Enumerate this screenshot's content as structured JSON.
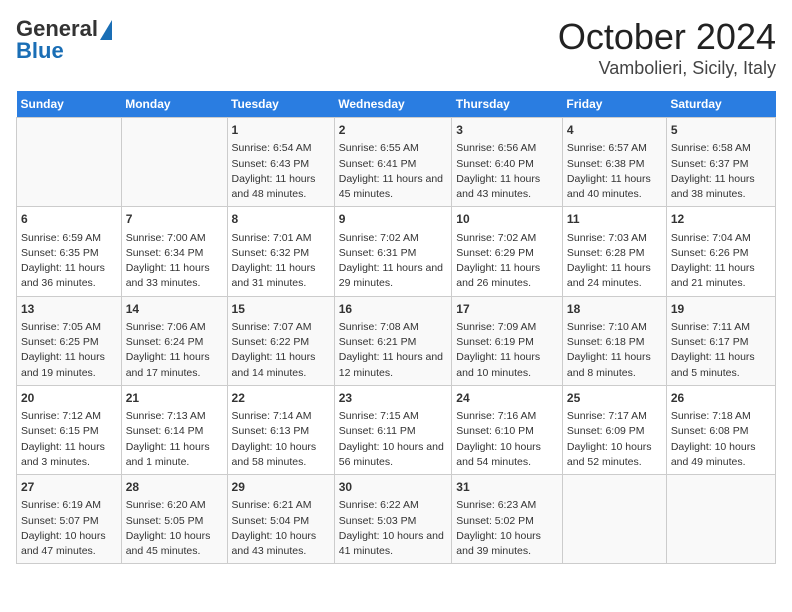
{
  "header": {
    "logo_line1": "General",
    "logo_line2": "Blue",
    "title": "October 2024",
    "subtitle": "Vambolieri, Sicily, Italy"
  },
  "days_of_week": [
    "Sunday",
    "Monday",
    "Tuesday",
    "Wednesday",
    "Thursday",
    "Friday",
    "Saturday"
  ],
  "weeks": [
    [
      {
        "day": "",
        "content": ""
      },
      {
        "day": "",
        "content": ""
      },
      {
        "day": "1",
        "content": "Sunrise: 6:54 AM\nSunset: 6:43 PM\nDaylight: 11 hours and 48 minutes."
      },
      {
        "day": "2",
        "content": "Sunrise: 6:55 AM\nSunset: 6:41 PM\nDaylight: 11 hours and 45 minutes."
      },
      {
        "day": "3",
        "content": "Sunrise: 6:56 AM\nSunset: 6:40 PM\nDaylight: 11 hours and 43 minutes."
      },
      {
        "day": "4",
        "content": "Sunrise: 6:57 AM\nSunset: 6:38 PM\nDaylight: 11 hours and 40 minutes."
      },
      {
        "day": "5",
        "content": "Sunrise: 6:58 AM\nSunset: 6:37 PM\nDaylight: 11 hours and 38 minutes."
      }
    ],
    [
      {
        "day": "6",
        "content": "Sunrise: 6:59 AM\nSunset: 6:35 PM\nDaylight: 11 hours and 36 minutes."
      },
      {
        "day": "7",
        "content": "Sunrise: 7:00 AM\nSunset: 6:34 PM\nDaylight: 11 hours and 33 minutes."
      },
      {
        "day": "8",
        "content": "Sunrise: 7:01 AM\nSunset: 6:32 PM\nDaylight: 11 hours and 31 minutes."
      },
      {
        "day": "9",
        "content": "Sunrise: 7:02 AM\nSunset: 6:31 PM\nDaylight: 11 hours and 29 minutes."
      },
      {
        "day": "10",
        "content": "Sunrise: 7:02 AM\nSunset: 6:29 PM\nDaylight: 11 hours and 26 minutes."
      },
      {
        "day": "11",
        "content": "Sunrise: 7:03 AM\nSunset: 6:28 PM\nDaylight: 11 hours and 24 minutes."
      },
      {
        "day": "12",
        "content": "Sunrise: 7:04 AM\nSunset: 6:26 PM\nDaylight: 11 hours and 21 minutes."
      }
    ],
    [
      {
        "day": "13",
        "content": "Sunrise: 7:05 AM\nSunset: 6:25 PM\nDaylight: 11 hours and 19 minutes."
      },
      {
        "day": "14",
        "content": "Sunrise: 7:06 AM\nSunset: 6:24 PM\nDaylight: 11 hours and 17 minutes."
      },
      {
        "day": "15",
        "content": "Sunrise: 7:07 AM\nSunset: 6:22 PM\nDaylight: 11 hours and 14 minutes."
      },
      {
        "day": "16",
        "content": "Sunrise: 7:08 AM\nSunset: 6:21 PM\nDaylight: 11 hours and 12 minutes."
      },
      {
        "day": "17",
        "content": "Sunrise: 7:09 AM\nSunset: 6:19 PM\nDaylight: 11 hours and 10 minutes."
      },
      {
        "day": "18",
        "content": "Sunrise: 7:10 AM\nSunset: 6:18 PM\nDaylight: 11 hours and 8 minutes."
      },
      {
        "day": "19",
        "content": "Sunrise: 7:11 AM\nSunset: 6:17 PM\nDaylight: 11 hours and 5 minutes."
      }
    ],
    [
      {
        "day": "20",
        "content": "Sunrise: 7:12 AM\nSunset: 6:15 PM\nDaylight: 11 hours and 3 minutes."
      },
      {
        "day": "21",
        "content": "Sunrise: 7:13 AM\nSunset: 6:14 PM\nDaylight: 11 hours and 1 minute."
      },
      {
        "day": "22",
        "content": "Sunrise: 7:14 AM\nSunset: 6:13 PM\nDaylight: 10 hours and 58 minutes."
      },
      {
        "day": "23",
        "content": "Sunrise: 7:15 AM\nSunset: 6:11 PM\nDaylight: 10 hours and 56 minutes."
      },
      {
        "day": "24",
        "content": "Sunrise: 7:16 AM\nSunset: 6:10 PM\nDaylight: 10 hours and 54 minutes."
      },
      {
        "day": "25",
        "content": "Sunrise: 7:17 AM\nSunset: 6:09 PM\nDaylight: 10 hours and 52 minutes."
      },
      {
        "day": "26",
        "content": "Sunrise: 7:18 AM\nSunset: 6:08 PM\nDaylight: 10 hours and 49 minutes."
      }
    ],
    [
      {
        "day": "27",
        "content": "Sunrise: 6:19 AM\nSunset: 5:07 PM\nDaylight: 10 hours and 47 minutes."
      },
      {
        "day": "28",
        "content": "Sunrise: 6:20 AM\nSunset: 5:05 PM\nDaylight: 10 hours and 45 minutes."
      },
      {
        "day": "29",
        "content": "Sunrise: 6:21 AM\nSunset: 5:04 PM\nDaylight: 10 hours and 43 minutes."
      },
      {
        "day": "30",
        "content": "Sunrise: 6:22 AM\nSunset: 5:03 PM\nDaylight: 10 hours and 41 minutes."
      },
      {
        "day": "31",
        "content": "Sunrise: 6:23 AM\nSunset: 5:02 PM\nDaylight: 10 hours and 39 minutes."
      },
      {
        "day": "",
        "content": ""
      },
      {
        "day": "",
        "content": ""
      }
    ]
  ]
}
